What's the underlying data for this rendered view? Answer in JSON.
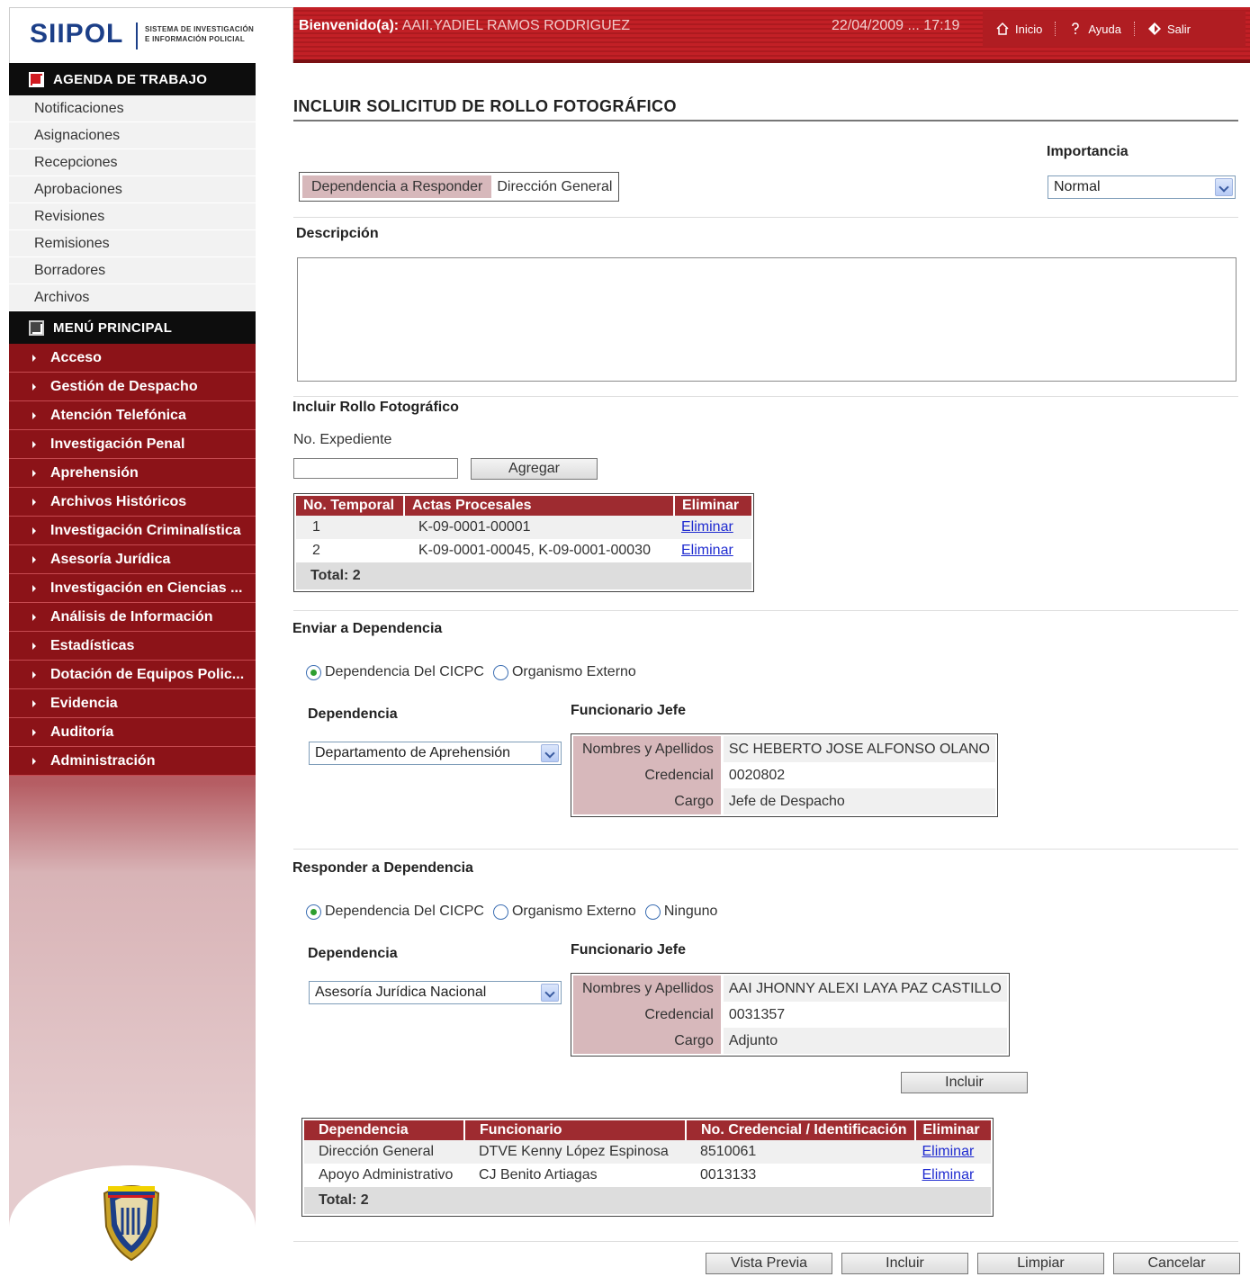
{
  "header": {
    "logo": "SIIPOL",
    "logo_subtitle_line1": "SISTEMA DE INVESTIGACIÓN",
    "logo_subtitle_line2": "E INFORMACIÓN POLICIAL",
    "welcome_label": "Bienvenido(a):",
    "user": "AAII.YADIEL RAMOS RODRIGUEZ",
    "datetime": "22/04/2009 ... 17:19",
    "links": {
      "home": "Inicio",
      "help": "Ayuda",
      "exit": "Salir"
    }
  },
  "sidebar": {
    "agenda_title": "AGENDA DE TRABAJO",
    "agenda_items": [
      "Notificaciones",
      "Asignaciones",
      "Recepciones",
      "Aprobaciones",
      "Revisiones",
      "Remisiones",
      "Borradores",
      "Archivos"
    ],
    "menu_title": "MENÚ PRINCIPAL",
    "menu_items": [
      "Acceso",
      "Gestión de Despacho",
      "Atención Telefónica",
      "Investigación Penal",
      "Aprehensión",
      "Archivos Históricos",
      "Investigación Criminalística",
      "Asesoría Jurídica",
      "Investigación en Ciencias ...",
      "Análisis de Información",
      "Estadísticas",
      "Dotación de Equipos Polic...",
      "Evidencia",
      "Auditoría",
      "Administración"
    ]
  },
  "main": {
    "title": "INCLUIR SOLICITUD DE ROLLO FOTOGRÁFICO",
    "dependencia_responder_label": "Dependencia a Responder",
    "dependencia_responder_value": "Dirección General",
    "importancia_label": "Importancia",
    "importancia_value": "Normal",
    "descripcion_label": "Descripción",
    "descripcion_value": "",
    "rollo_section": "Incluir Rollo Fotográfico",
    "expediente_label": "No. Expediente",
    "expediente_value": "",
    "agregar_button": "Agregar",
    "rollo_table": {
      "headers": [
        "No. Temporal",
        "Actas Procesales",
        "Eliminar"
      ],
      "rows": [
        {
          "no": "1",
          "actas": "K-09-0001-00001",
          "action": "Eliminar"
        },
        {
          "no": "2",
          "actas": "K-09-0001-00045, K-09-0001-00030",
          "action": "Eliminar"
        }
      ],
      "total": "Total: 2"
    },
    "enviar": {
      "section": "Enviar a Dependencia",
      "radio_options": [
        "Dependencia Del CICPC",
        "Organismo Externo"
      ],
      "selected_index": 0,
      "dependencia_label": "Dependencia",
      "funcionario_label": "Funcionario Jefe",
      "dependencia_value": "Departamento de Aprehensión",
      "info": {
        "nombres_label": "Nombres y Apellidos",
        "nombres_value": "SC HEBERTO JOSE ALFONSO OLANO",
        "credencial_label": "Credencial",
        "credencial_value": "0020802",
        "cargo_label": "Cargo",
        "cargo_value": "Jefe de Despacho"
      }
    },
    "responder": {
      "section": "Responder a Dependencia",
      "radio_options": [
        "Dependencia Del CICPC",
        "Organismo Externo",
        "Ninguno"
      ],
      "selected_index": 0,
      "dependencia_label": "Dependencia",
      "funcionario_label": "Funcionario Jefe",
      "dependencia_value": "Asesoría Jurídica Nacional",
      "info": {
        "nombres_label": "Nombres y Apellidos",
        "nombres_value": "AAI JHONNY ALEXI LAYA PAZ CASTILLO",
        "credencial_label": "Credencial",
        "credencial_value": "0031357",
        "cargo_label": "Cargo",
        "cargo_value": "Adjunto"
      },
      "incluir_button": "Incluir"
    },
    "dep_table": {
      "headers": [
        "Dependencia",
        "Funcionario",
        "No. Credencial / Identificación",
        "Eliminar"
      ],
      "rows": [
        {
          "dependencia": "Dirección General",
          "funcionario": "DTVE Kenny López Espinosa",
          "credencial": "8510061",
          "action": "Eliminar"
        },
        {
          "dependencia": "Apoyo Administrativo",
          "funcionario": "CJ Benito Artiagas",
          "credencial": "0013133",
          "action": "Eliminar"
        }
      ],
      "total": "Total: 2"
    },
    "buttons": {
      "preview": "Vista Previa",
      "include": "Incluir",
      "clear": "Limpiar",
      "cancel": "Cancelar"
    }
  },
  "colors": {
    "brand_red": "#c22026",
    "menu_red": "#8c1318",
    "header_table": "#9e2b30",
    "label_pink": "#d7b8bb",
    "logo_blue": "#1c3f88"
  }
}
